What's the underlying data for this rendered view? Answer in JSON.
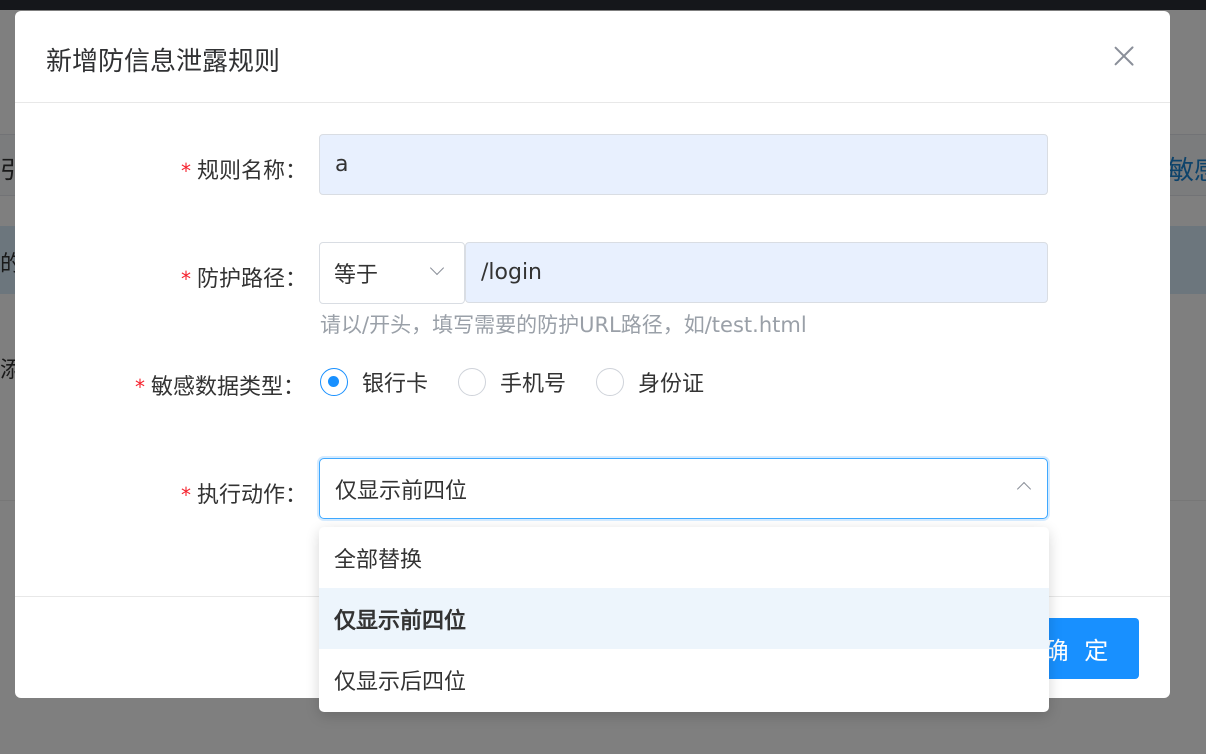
{
  "background": {
    "left_text": "引",
    "right_link": "敏感",
    "blue_row_text": "的",
    "row_text": "添"
  },
  "dialog": {
    "title": "新增防信息泄露规则",
    "close_icon": "close-icon"
  },
  "form": {
    "rule_name": {
      "required": "*",
      "label": "规则名称：",
      "value": "a"
    },
    "path": {
      "required": "*",
      "label": "防护路径：",
      "match_type": "等于",
      "value": "/login",
      "hint": "请以/开头，填写需要的防护URL路径，如/test.html"
    },
    "data_type": {
      "required": "*",
      "label": "敏感数据类型：",
      "options": [
        "银行卡",
        "手机号",
        "身份证"
      ],
      "selected": "银行卡"
    },
    "action": {
      "required": "*",
      "label": "执行动作：",
      "value": "仅显示前四位",
      "options": [
        "全部替换",
        "仅显示前四位",
        "仅显示后四位"
      ]
    }
  },
  "footer": {
    "ok_label": "确 定"
  },
  "colors": {
    "primary": "#1890ff",
    "required": "#f5222d",
    "input_fill": "#e8f0fe"
  }
}
